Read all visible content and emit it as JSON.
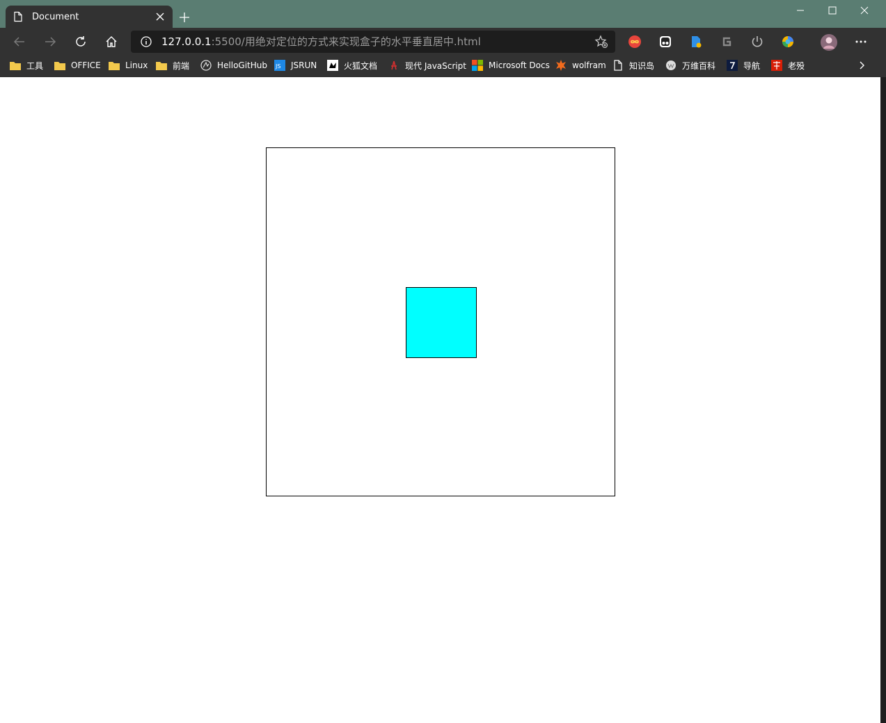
{
  "browser": {
    "tab": {
      "title": "Document"
    },
    "url": {
      "host": "127.0.0.1",
      "path": ":5500/用绝对定位的方式来实现盒子的水平垂直居中.html"
    },
    "bookmarks": [
      {
        "label": "工具",
        "icon": "folder-icon"
      },
      {
        "label": "OFFICE",
        "icon": "folder-icon"
      },
      {
        "label": "Linux",
        "icon": "folder-icon"
      },
      {
        "label": "前端",
        "icon": "folder-icon"
      },
      {
        "label": "HelloGitHub",
        "icon": "hellogithub-icon"
      },
      {
        "label": "JSRUN",
        "icon": "jsrun-icon"
      },
      {
        "label": "火狐文档",
        "icon": "mdn-icon"
      },
      {
        "label": "现代 JavaScript",
        "icon": "javascript-info-icon"
      },
      {
        "label": "Microsoft Docs",
        "icon": "microsoft-icon"
      },
      {
        "label": "wolfram",
        "icon": "wolfram-icon"
      },
      {
        "label": "知识岛",
        "icon": "page-icon"
      },
      {
        "label": "万维百科",
        "icon": "wiki-icon"
      },
      {
        "label": "导航",
        "icon": "nav-icon"
      },
      {
        "label": "老殁",
        "icon": "laomo-icon"
      }
    ]
  },
  "colors": {
    "titlebar": "#5a7d72",
    "toolbar": "#323232",
    "inner_box": "#00ffff",
    "outer_box_border": "#000000"
  }
}
